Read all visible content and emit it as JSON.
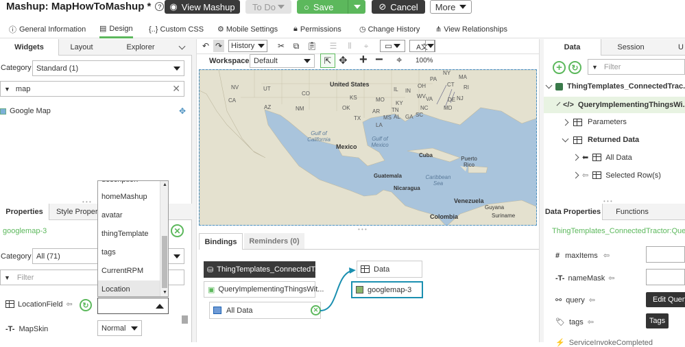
{
  "header": {
    "title": "Mashup: MapHowToMashup *",
    "view_mashup": "View Mashup",
    "todo": "To Do",
    "save": "Save",
    "cancel": "Cancel",
    "more": "More"
  },
  "tabs": [
    "General Information",
    "Design",
    "{..} Custom CSS",
    "Mobile Settings",
    "Permissions",
    "Change History",
    "View Relationships"
  ],
  "left": {
    "tabs": [
      "Widgets",
      "Layout",
      "Explorer"
    ],
    "category_label": "Category",
    "category_value": "Standard (1)",
    "filter_value": "map",
    "widget_item": "Google Map"
  },
  "dropdown": {
    "items": [
      "description",
      "homeMashup",
      "avatar",
      "thingTemplate",
      "tags",
      "CurrentRPM",
      "Location"
    ]
  },
  "props": {
    "tabs": [
      "Properties",
      "Style Propert"
    ],
    "widget_name": "googlemap-3",
    "category_label": "Category",
    "category_value": "All (71)",
    "filter_placeholder": "Filter",
    "location_field": "LocationField",
    "map_skin": "MapSkin",
    "map_skin_value": "Normal"
  },
  "toolbar": {
    "history": "History",
    "workspace_label": "Workspace",
    "workspace_value": "Default",
    "zoom": "100%"
  },
  "map": {
    "labels": [
      "NV",
      "UT",
      "CO",
      "KS",
      "MO",
      "IL",
      "IN",
      "OH",
      "PA",
      "NY",
      "MA",
      "CT",
      "RI",
      "NJ",
      "MD",
      "DE",
      "VA",
      "WV",
      "KY",
      "TN",
      "NC",
      "AR",
      "MS",
      "AL",
      "GA",
      "SC",
      "OK",
      "TX",
      "LA",
      "AZ",
      "NM",
      "CA",
      "United States",
      "Gulf of California",
      "Mexico",
      "Gulf of Mexico",
      "Cuba",
      "Puerto Rico",
      "Guatemala",
      "Nicaragua",
      "Caribbean Sea",
      "Venezuela",
      "Guyana",
      "Colombia",
      "Suriname"
    ]
  },
  "bindings": {
    "tabs": [
      "Bindings",
      "Reminders (0)"
    ],
    "source_thing": "ThingTemplates_ConnectedT...",
    "source_service": "QueryImplementingThingsWit...",
    "source_data": "All Data",
    "target_data": "Data",
    "target_widget": "googlemap-3"
  },
  "right": {
    "tabs": [
      "Data",
      "Session",
      "U"
    ],
    "filter_placeholder": "Filter",
    "tree": [
      "ThingTemplates_ConnectedTrac...",
      "QueryImplementingThingsWi...",
      "Parameters",
      "Returned Data",
      "All Data",
      "Selected Row(s)"
    ]
  },
  "data_props": {
    "tabs": [
      "Data Properties",
      "Functions"
    ],
    "source": "ThingTemplates_ConnectedTractor:QueryI",
    "rows": [
      "maxItems",
      "nameMask",
      "query",
      "tags",
      "ServiceInvokeCompleted"
    ],
    "edit_query": "Edit Query",
    "tags_btn": "Tags"
  },
  "colors": {
    "accent": "#5cb85c",
    "header_dark": "#333333",
    "teal": "#1a8fb0",
    "map_water": "#a9c4dc",
    "map_land": "#e4e1cf"
  }
}
